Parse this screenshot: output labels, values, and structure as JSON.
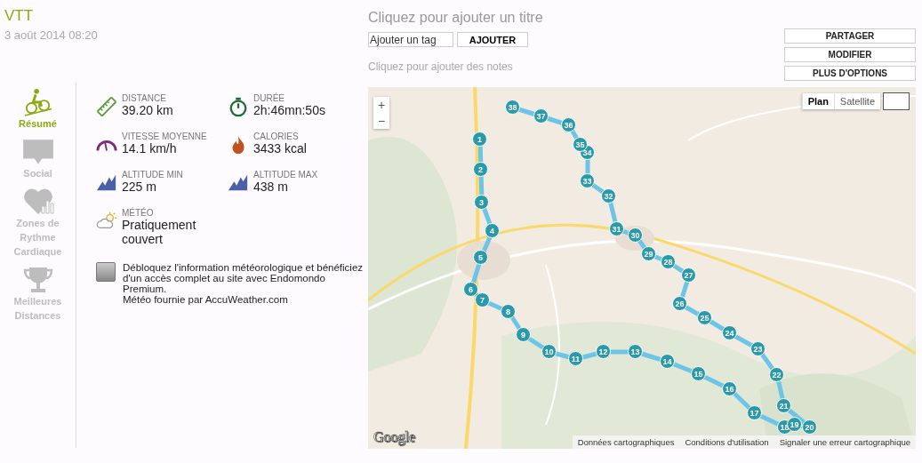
{
  "activity": {
    "sport": "VTT",
    "date": "3 août 2014 08:20"
  },
  "header": {
    "title_placeholder": "Cliquez pour ajouter un titre",
    "tag_placeholder": "Ajouter un tag",
    "add_button": "AJOUTER",
    "notes_placeholder": "Cliquez pour ajouter des notes"
  },
  "actions": [
    "PARTAGER",
    "MODIFIER",
    "PLUS D'OPTIONS"
  ],
  "sidebar": {
    "items": [
      {
        "kind": "summary",
        "label": "Résumé",
        "selected": true
      },
      {
        "kind": "social",
        "label": "Social",
        "selected": false
      },
      {
        "kind": "heart",
        "label": "Zones de Rythme Cardiaque",
        "selected": false
      },
      {
        "kind": "trophy",
        "label": "Meilleures Distances",
        "selected": false
      }
    ]
  },
  "stats": [
    {
      "kind": "distance",
      "label": "DISTANCE",
      "value": "39.20 km"
    },
    {
      "kind": "duration",
      "label": "DURÉE",
      "value": "2h:46mn:50s"
    },
    {
      "kind": "speed",
      "label": "VITESSE MOYENNE",
      "value": "14.1 km/h"
    },
    {
      "kind": "calories",
      "label": "CALORIES",
      "value": "3433 kcal"
    },
    {
      "kind": "altitude",
      "label": "ALTITUDE MIN",
      "value": "225 m"
    },
    {
      "kind": "altitude",
      "label": "ALTITUDE MAX",
      "value": "438 m"
    },
    {
      "kind": "weather",
      "label": "MÉTÉO",
      "value": "Pratiquement couvert"
    }
  ],
  "premium": {
    "text": "Débloquez l'information météorologique et bénéficiez d'un accès complet au site avec Endomondo Premium.",
    "credit": "Météo fournie par AccuWeather.com"
  },
  "map": {
    "zoom_in": "+",
    "zoom_out": "−",
    "types": [
      {
        "label": "Plan",
        "selected": true
      },
      {
        "label": "Satellite",
        "selected": false
      }
    ],
    "markers": [
      "1",
      "2",
      "3",
      "4",
      "5",
      "6",
      "7",
      "8",
      "9",
      "10",
      "11",
      "12",
      "13",
      "14",
      "15",
      "16",
      "17",
      "18",
      "19",
      "20",
      "21",
      "22",
      "23",
      "24",
      "25",
      "26",
      "27",
      "28",
      "29",
      "30",
      "31",
      "32",
      "33",
      "34",
      "35",
      "36",
      "37",
      "38"
    ],
    "logo": "Google",
    "links": [
      "Données cartographiques",
      "Conditions d'utilisation",
      "Signaler une erreur cartographique"
    ]
  }
}
